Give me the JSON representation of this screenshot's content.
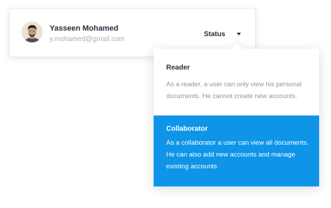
{
  "user": {
    "name": "Yasseen Mohamed",
    "email": "y.mohamed@gmail.com"
  },
  "status": {
    "label": "Status",
    "caret_icon": "caret-down-icon"
  },
  "dropdown": {
    "options": [
      {
        "title": "Reader",
        "description": "As a reader, a user can only view his personal documents. He cannot create new accounts.",
        "selected": false
      },
      {
        "title": "Collaborator",
        "description": "As a collaborator a user can view all documents. He can also add new accounts and manage existing accounts",
        "selected": true
      }
    ]
  },
  "colors": {
    "accent": "#0f95e8",
    "text_dark": "#2a2f3d",
    "text_muted": "#a7adb7"
  }
}
